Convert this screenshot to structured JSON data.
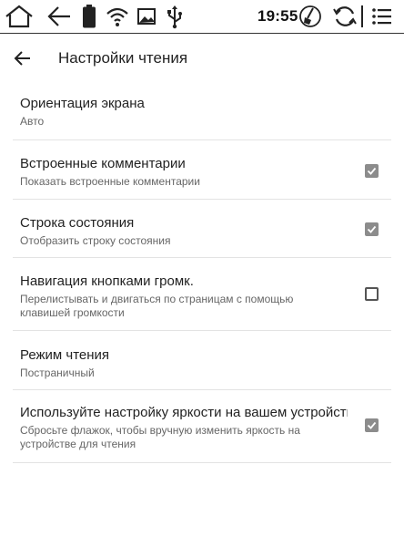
{
  "status_bar": {
    "time": "19:55",
    "icons": [
      "home-icon",
      "back-arrow-icon",
      "battery-icon",
      "wifi-icon",
      "image-icon",
      "usb-icon",
      "clean-icon",
      "refresh-icon",
      "menu-icon"
    ]
  },
  "header": {
    "title": "Настройки чтения"
  },
  "settings": [
    {
      "title": "Ориентация экрана",
      "subtitle": "Авто"
    },
    {
      "title": "Встроенные комментарии",
      "subtitle": "Показать встроенные комментарии",
      "checked": true
    },
    {
      "title": "Строка состояния",
      "subtitle": "Отобразить строку состояния",
      "checked": true
    },
    {
      "title": "Навигация кнопками громк.",
      "subtitle": "Перелистывать и двигаться по страницам с помощью клавишей громкости",
      "checked": false
    },
    {
      "title": "Режим чтения",
      "subtitle": "Постраничный"
    },
    {
      "title": "Используйте настройку яркости на вашем устройстве",
      "subtitle": "Сбросьте флажок, чтобы вручную изменить яркость на устройстве для чтения",
      "checked": true
    }
  ],
  "colors": {
    "checkbox_checked": "#8c8c8c",
    "divider": "#e3e3e3",
    "text_primary": "#222222",
    "text_secondary": "#666666"
  }
}
